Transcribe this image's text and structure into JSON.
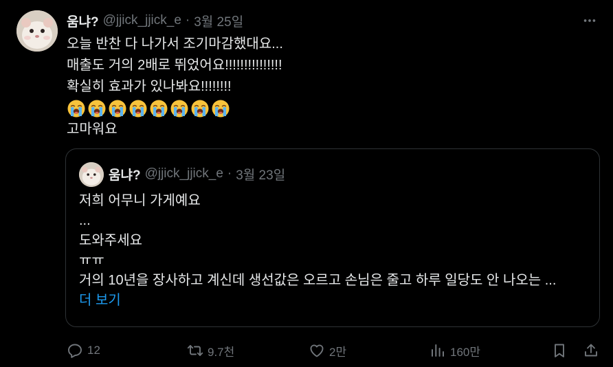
{
  "tweet": {
    "author_name": "움냐?",
    "author_handle": "@jjick_jjick_e",
    "separator": "·",
    "date": "3월 25일",
    "lines": [
      "오늘 반찬 다 나가서 조기마감했대요...",
      "매출도 거의 2배로 뛰었어요!!!!!!!!!!!!!!!",
      "확실히 효과가 있나봐요!!!!!!!!",
      "고마워요"
    ],
    "emoji_name": "loudly-crying-face",
    "emoji_count": 8
  },
  "quote": {
    "author_name": "움냐?",
    "author_handle": "@jjick_jjick_e",
    "separator": "·",
    "date": "3월 23일",
    "lines": [
      "저희 어무니 가게예요",
      "...",
      "도와주세요",
      "ㅠㅠ",
      "거의 10년을 장사하고 계신데 생선값은 오르고 손님은 줄고 하루 일당도 안 나오는 ..."
    ],
    "show_more": "더 보기"
  },
  "actions": {
    "reply_count": "12",
    "retweet_count": "9.7천",
    "like_count": "2만",
    "view_count": "160만"
  },
  "colors": {
    "background": "#000000",
    "text": "#e7e9ea",
    "muted": "#71767b",
    "link": "#1d9bf0",
    "border": "#2f3336"
  },
  "icons": [
    "more-icon",
    "reply-icon",
    "retweet-icon",
    "like-icon",
    "views-icon",
    "bookmark-icon",
    "share-icon"
  ]
}
